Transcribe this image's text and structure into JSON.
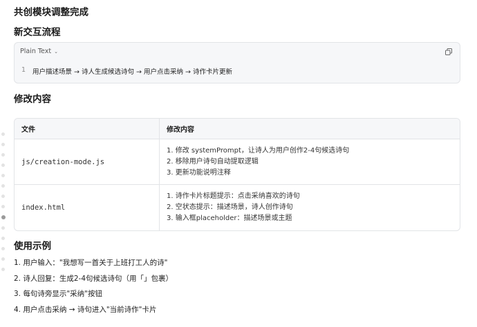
{
  "doc": {
    "title": "共创模块调整完成",
    "flow_heading": "新交互流程",
    "code": {
      "language_label": "Plain Text",
      "line_number": "1",
      "line_text": "用户描述场景 → 诗人生成候选诗句 → 用户点击采纳 → 诗作卡片更新"
    },
    "changes_heading": "修改内容",
    "table": {
      "headers": [
        "文件",
        "修改内容"
      ],
      "rows": [
        {
          "file": "js/creation-mode.js",
          "lines": [
            "1. 修改 systemPrompt，让诗人为用户创作2-4句候选诗句",
            "2. 移除用户诗句自动提取逻辑",
            "3. 更新功能说明注释"
          ]
        },
        {
          "file": "index.html",
          "lines": [
            "1. 诗作卡片标题提示：点击采纳喜欢的诗句",
            "2. 空状态提示：描述场景，诗人创作诗句",
            "3. 输入框placeholder：描述场景或主题"
          ]
        }
      ]
    },
    "examples_heading": "使用示例",
    "examples": [
      "1. 用户输入：\"我想写一首关于上班打工人的诗\"",
      "2. 诗人回复：生成2-4句候选诗句（用「」包裹）",
      "3. 每句诗旁显示\"采纳\"按钮",
      "4. 用户点击采纳 → 诗句进入\"当前诗作\"卡片"
    ]
  }
}
